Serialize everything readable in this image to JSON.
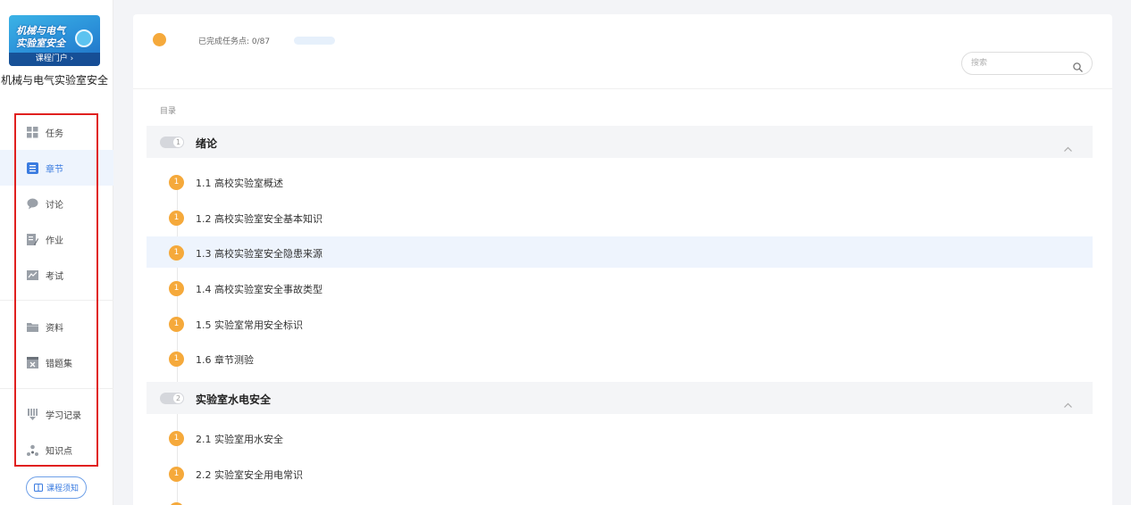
{
  "course": {
    "cover_line1": "机械与电气",
    "cover_line2": "实验室安全",
    "portal_link": "课程门户 ›",
    "title": "机械与电气实验室安全"
  },
  "nav": {
    "items": [
      {
        "label": "任务",
        "icon": "grid-icon",
        "active": false
      },
      {
        "label": "章节",
        "icon": "list-icon",
        "active": true
      },
      {
        "label": "讨论",
        "icon": "chat-icon",
        "active": false
      },
      {
        "label": "作业",
        "icon": "pencil-doc-icon",
        "active": false
      },
      {
        "label": "考试",
        "icon": "exam-icon",
        "active": false
      },
      {
        "label": "资料",
        "icon": "folder-icon",
        "active": false
      },
      {
        "label": "错题集",
        "icon": "wrong-box-icon",
        "active": false
      },
      {
        "label": "学习记录",
        "icon": "record-icon",
        "active": false
      },
      {
        "label": "知识点",
        "icon": "knowledge-icon",
        "active": false
      }
    ],
    "notice_label": "课程须知"
  },
  "header": {
    "progress_label": "已完成任务点: 0/87",
    "progress_fraction": 0,
    "search_placeholder": "搜索"
  },
  "toc": {
    "label": "目录",
    "chapters": [
      {
        "number": "1",
        "title": "绪论",
        "sections": [
          {
            "badge": "1",
            "title": "1.1 高校实验室概述"
          },
          {
            "badge": "1",
            "title": "1.2 高校实验室安全基本知识"
          },
          {
            "badge": "1",
            "title": "1.3 高校实验室安全隐患来源"
          },
          {
            "badge": "1",
            "title": "1.4 高校实验室安全事故类型"
          },
          {
            "badge": "1",
            "title": "1.5 实验室常用安全标识"
          },
          {
            "badge": "1",
            "title": "1.6 章节测验"
          }
        ]
      },
      {
        "number": "2",
        "title": "实验室水电安全",
        "sections": [
          {
            "badge": "1",
            "title": "2.1 实验室用水安全"
          },
          {
            "badge": "1",
            "title": "2.2 实验室安全用电常识"
          }
        ]
      }
    ]
  },
  "colors": {
    "accent": "#3a7be0",
    "badge_orange": "#f5a93b",
    "highlight_border": "#e0201f"
  }
}
